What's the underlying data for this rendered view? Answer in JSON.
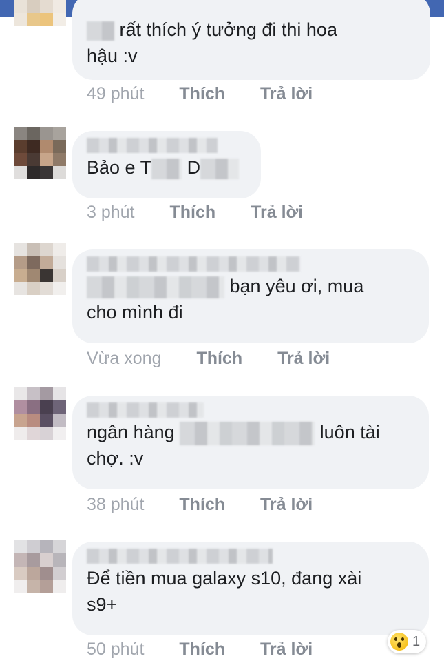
{
  "comments": [
    {
      "text": "rất thích ý tưởng đi thi hoa hậu :v",
      "line1": "rất thích ý tưởng đi thi hoa",
      "line2": "hậu :v",
      "time": "49 phút",
      "like": "Thích",
      "reply": "Trả lời"
    },
    {
      "text_prefix": "Bảo e T",
      "text_mid": "D",
      "time": "3 phút",
      "like": "Thích",
      "reply": "Trả lời"
    },
    {
      "text_line1_suffix": "bạn yêu ơi, mua",
      "line2": "cho mình đi",
      "time": "Vừa xong",
      "like": "Thích",
      "reply": "Trả lời"
    },
    {
      "line1_prefix": "ngân hàng",
      "line1_suffix": "luôn tài",
      "line2": "chợ. :v",
      "time": "38 phút",
      "like": "Thích",
      "reply": "Trả lời"
    },
    {
      "line1": "Để tiền mua galaxy s10, đang xài",
      "line2": "s9+",
      "time": "50 phút",
      "like": "Thích",
      "reply": "Trả lời",
      "reaction_count": "1"
    }
  ],
  "colors": {
    "topbar": "#4267b2",
    "bubble": "#f0f2f5",
    "text": "#1c1e21",
    "meta": "#8d949e"
  },
  "icons": [
    "wow-reaction-icon"
  ]
}
